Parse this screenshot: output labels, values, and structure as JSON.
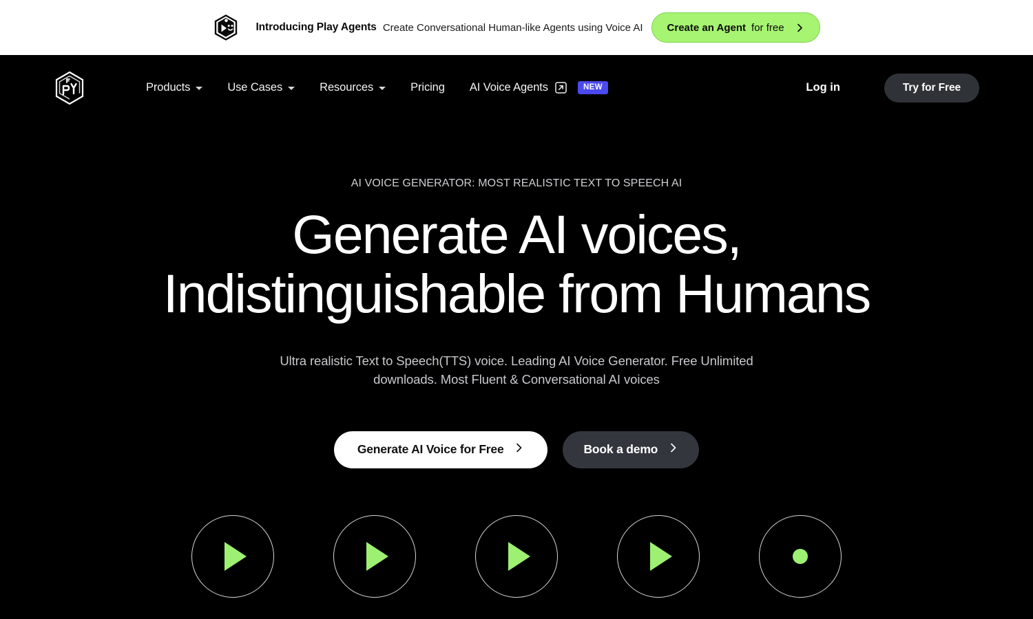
{
  "promo_banner": {
    "logo_icon": "playht-cube-icon",
    "title": "Introducing Play Agents",
    "subtitle": "Create Conversational Human-like Agents using Voice AI",
    "cta_strong": "Create an Agent",
    "cta_light": "for free",
    "cta_chevron_icon": "chevron-right-icon",
    "background_color": "#ffffff",
    "cta_color": "#a6f472"
  },
  "header": {
    "logo_icon": "playht-logo-icon",
    "nav": [
      {
        "label": "Products",
        "has_caret": true,
        "caret_icon": "chevron-down-icon"
      },
      {
        "label": "Use Cases",
        "has_caret": true,
        "caret_icon": "chevron-down-icon"
      },
      {
        "label": "Resources",
        "has_caret": true,
        "caret_icon": "chevron-down-icon"
      },
      {
        "label": "Pricing",
        "has_caret": false
      },
      {
        "label": "AI Voice Agents",
        "has_caret": false,
        "external_icon": "external-link-icon",
        "badge": "NEW",
        "badge_color": "#4b49f0"
      }
    ],
    "login_label": "Log in",
    "try_free_label": "Try for Free",
    "background_color": "#000000"
  },
  "hero": {
    "eyebrow": "AI VOICE GENERATOR: MOST REALISTIC TEXT TO SPEECH AI",
    "headline": "Generate AI voices, Indistinguishable from Humans",
    "subheading": "Ultra realistic Text to Speech(TTS) voice. Leading AI Voice Generator. Free Unlimited downloads. Most Fluent & Conversational AI voices",
    "primary_cta": "Generate AI Voice for Free",
    "primary_cta_icon": "chevron-right-icon",
    "secondary_cta": "Book a demo",
    "secondary_cta_icon": "chevron-right-icon",
    "accent_green": "#9df072"
  },
  "voice_samples": [
    {
      "icon": "play-icon"
    },
    {
      "icon": "play-icon"
    },
    {
      "icon": "play-icon"
    },
    {
      "icon": "play-icon"
    },
    {
      "icon": "record-dot-icon"
    }
  ]
}
